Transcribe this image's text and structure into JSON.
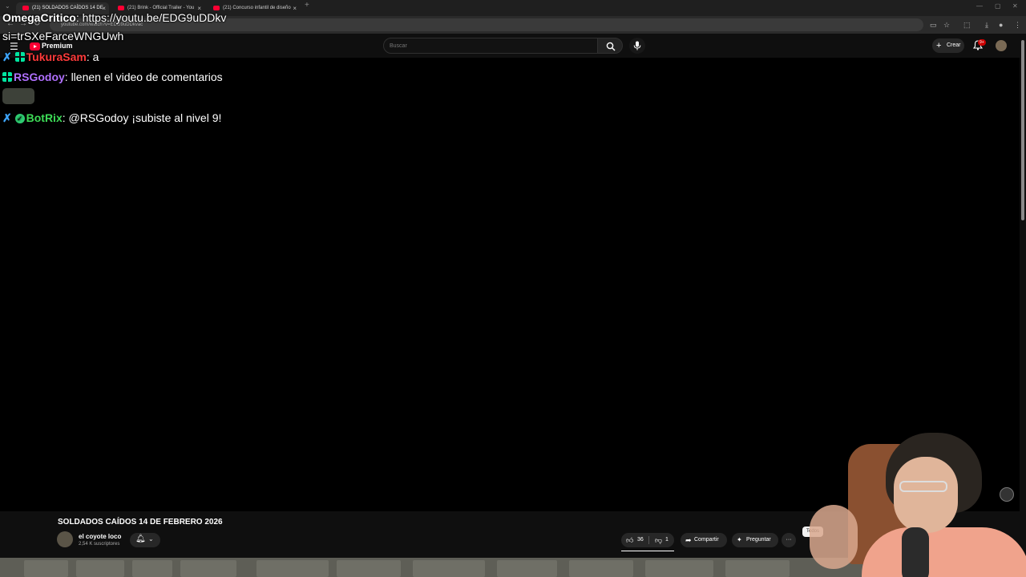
{
  "browser": {
    "tabs": [
      {
        "label": "(21) SOLDADOS CAÍDOS 14 DE",
        "active": true
      },
      {
        "label": "(21) Brink - Official Trailer - You",
        "active": false
      },
      {
        "label": "(21) Concurso infantil de diseño",
        "active": false
      }
    ],
    "new_tab_label": "+",
    "close_label": "×",
    "url": "youtube.com/watch?v=EDG9uDDkvac"
  },
  "header": {
    "premium_label": "Premium",
    "search_placeholder": "Buscar",
    "create_label": "Crear",
    "notification_badge": "9+"
  },
  "chat": {
    "messages": [
      {
        "user": "OmegaCritico",
        "sep": ": ",
        "text": "https://youtu.be/EDG9uDDkv",
        "user_color": "#ffffff"
      },
      {
        "user": "",
        "sep": "",
        "text": "si=trSXeFarceWNGUwh",
        "user_color": "#ffffff"
      },
      {
        "user": "TukuraSam",
        "sep": ": ",
        "text": "a",
        "user_color": "#ff3b3b"
      },
      {
        "user": "RSGodoy",
        "sep": ": ",
        "text": "llenen el video de comentarios",
        "user_color": "#b070ff"
      },
      {
        "user": "BotRix",
        "sep": ": ",
        "text": "@RSGodoy ¡subiste al nivel 9!",
        "user_color": "#3ddc57"
      }
    ]
  },
  "video": {
    "title": "SOLDADOS CAÍDOS 14 DE FEBRERO 2026",
    "channel": "el coyote loco",
    "subscribers": "2,54 K suscriptores",
    "likes": "36",
    "dislikes": "1",
    "share_label": "Compartir",
    "ask_label": "Preguntar",
    "more_label": "···",
    "chip_label": "Todos"
  },
  "colors": {
    "accent": "#ff0033",
    "background": "#0f0f0f"
  }
}
